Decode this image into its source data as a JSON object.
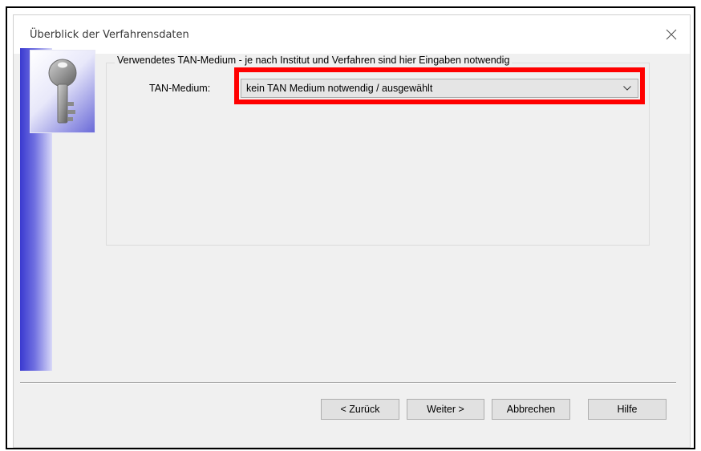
{
  "window": {
    "title": "Überblick der Verfahrensdaten",
    "close_icon": "close-icon"
  },
  "banner": {
    "icon": "key-icon"
  },
  "group": {
    "legend": "Verwendetes TAN-Medium - je nach Institut und Verfahren sind hier Eingaben notwendig",
    "tan_medium_label": "TAN-Medium:",
    "tan_medium_value": "kein TAN Medium notwendig / ausgewählt",
    "highlight_color": "#ff0000"
  },
  "buttons": {
    "back": "< Zurück",
    "next": "Weiter >",
    "cancel": "Abbrechen",
    "help": "Hilfe"
  }
}
